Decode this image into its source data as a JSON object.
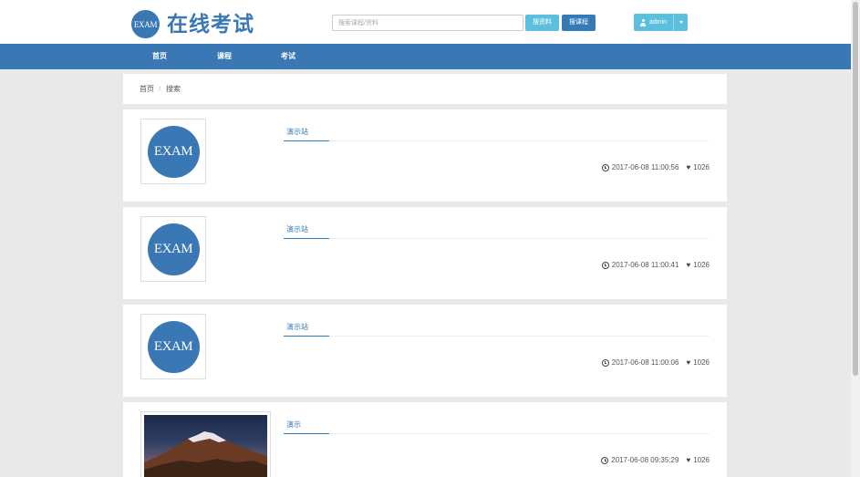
{
  "header": {
    "logo_mark": "EXAM",
    "site_title": "在线考试",
    "search_placeholder": "搜索课程/资料",
    "search_material_label": "搜资料",
    "search_course_label": "搜课程",
    "user_label": "admin"
  },
  "nav": {
    "items": [
      {
        "label": "首页"
      },
      {
        "label": "课程"
      },
      {
        "label": "考试"
      }
    ]
  },
  "breadcrumb": {
    "home": "首页",
    "separator": "/",
    "current": "搜索"
  },
  "results": [
    {
      "thumb_text": "EXAM",
      "title": "演示站",
      "time": "2017-06-08 11:00:56",
      "likes": "1026"
    },
    {
      "thumb_text": "EXAM",
      "title": "演示站",
      "time": "2017-06-08 11:00:41",
      "likes": "1026"
    },
    {
      "thumb_text": "EXAM",
      "title": "演示站",
      "time": "2017-06-08 11:00:06",
      "likes": "1026"
    },
    {
      "thumb_text": "",
      "title": "演示",
      "time": "2017-06-08 09:35:29",
      "likes": "1026"
    }
  ],
  "colors": {
    "brand": "#3a78b5",
    "info": "#5bc0de",
    "background": "#e9e9e9"
  }
}
